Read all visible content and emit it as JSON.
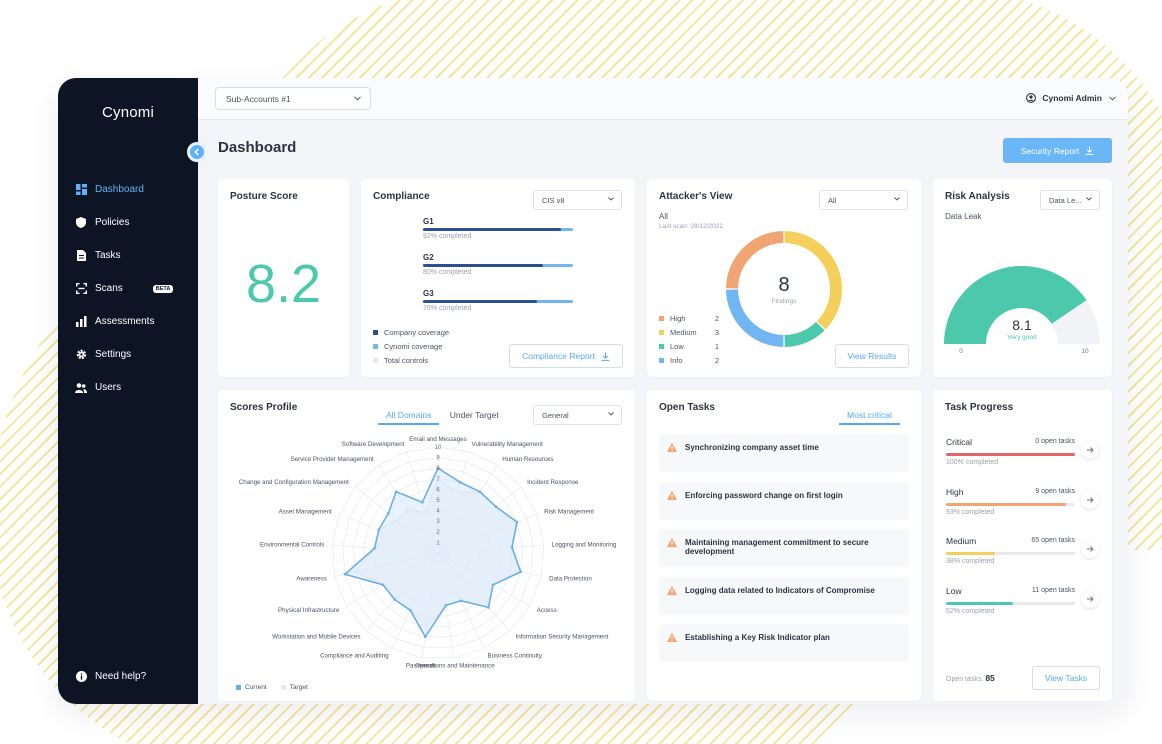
{
  "colors": {
    "sidebar_bg": "#0d1424",
    "accent": "#5fb2f7",
    "teal": "#4cc8ac",
    "orange": "#f0a572",
    "yellow": "#f5cf5c",
    "blue": "#71b6f0",
    "navy": "#2c4f8f",
    "red": "#e0666c"
  },
  "sidebar": {
    "logo": "Cynomi",
    "items": [
      {
        "label": "Dashboard",
        "icon": "grid-icon",
        "active": true
      },
      {
        "label": "Policies",
        "icon": "shield-icon"
      },
      {
        "label": "Tasks",
        "icon": "document-icon"
      },
      {
        "label": "Scans",
        "icon": "scan-icon",
        "badge": "BETA"
      },
      {
        "label": "Assessments",
        "icon": "bar-chart-icon"
      },
      {
        "label": "Settings",
        "icon": "gear-icon"
      },
      {
        "label": "Users",
        "icon": "users-icon"
      }
    ],
    "help": "Need help?"
  },
  "topbar": {
    "subaccount": "Sub-Accounts #1",
    "user": "Cynomi Admin"
  },
  "page": {
    "title": "Dashboard",
    "security_report": "Security Report"
  },
  "posture": {
    "title": "Posture Score",
    "score": "8.2"
  },
  "compliance": {
    "title": "Compliance",
    "select": "CIS v8",
    "groups": [
      {
        "label": "G1",
        "company": 0.92,
        "sub": "92% completed"
      },
      {
        "label": "G2",
        "company": 0.8,
        "sub": "80% completed"
      },
      {
        "label": "G3",
        "company": 0.76,
        "sub": "76% completed"
      }
    ],
    "legend": [
      "Company coverage",
      "Cynomi coverage",
      "Total controls"
    ],
    "button": "Compliance Report"
  },
  "attacker": {
    "title": "Attacker's View",
    "select": "All",
    "scope": "All",
    "last_scan": "Last scan: 28/12/2022",
    "total": "8",
    "total_label": "Findings",
    "severities": [
      {
        "label": "High",
        "value": 2,
        "color": "#f0a572"
      },
      {
        "label": "Medium",
        "value": 3,
        "color": "#f5cf5c"
      },
      {
        "label": "Low",
        "value": 1,
        "color": "#4cc8ac"
      },
      {
        "label": "Info",
        "value": 2,
        "color": "#71b6f0"
      }
    ],
    "button": "View Results"
  },
  "risk": {
    "title": "Risk Analysis",
    "select": "Data Le...",
    "subtitle": "Data Leak",
    "value": 8.1,
    "value_text": "8.1",
    "rating": "Very good",
    "min": "0",
    "max": "10"
  },
  "scores": {
    "title": "Scores Profile",
    "tabs": [
      "All Domains",
      "Under Target"
    ],
    "select": "General",
    "legend_current": "Current",
    "legend_target": "Target",
    "ticks": [
      "1",
      "2",
      "3",
      "4",
      "5",
      "6",
      "7",
      "8",
      "9",
      "10"
    ]
  },
  "chart_data": {
    "type": "radar",
    "rmax": 10,
    "categories": [
      "Email and Messages",
      "Vulnerability Management",
      "Human Resources",
      "Incident Response",
      "Risk Management",
      "Logging and Monitoring",
      "Data Protection",
      "Access",
      "Information Security Management",
      "Business Continuity",
      "Operations and Maintenance",
      "Passwords",
      "Compliance and Auditing",
      "Workstation and Mobile Devices",
      "Physical Infrastructure",
      "Awareness",
      "Environmental Controls",
      "Asset Management",
      "Change and Configuration Management",
      "Service Provider Management",
      "Software Development"
    ],
    "series": [
      {
        "name": "Current",
        "values": [
          8,
          7,
          7,
          7,
          8,
          7,
          8,
          6,
          7,
          5,
          5,
          8,
          6,
          6,
          6,
          9,
          6,
          6,
          6,
          7,
          5
        ]
      },
      {
        "name": "Target",
        "values": [
          7,
          6,
          7,
          7,
          8,
          7,
          8,
          6,
          7,
          5,
          5,
          7,
          6,
          6,
          6,
          8,
          6,
          6,
          5,
          5,
          4
        ]
      }
    ]
  },
  "open_tasks": {
    "title": "Open Tasks",
    "tab": "Most critical",
    "items": [
      "Synchronizing company asset time",
      "Enforcing password change on first login",
      "Maintaining management commitment to secure development",
      "Logging data related to Indicators of Compromise",
      "Establishing a Key Risk Indicator plan"
    ]
  },
  "task_progress": {
    "title": "Task Progress",
    "rows": [
      {
        "label": "Critical",
        "count": "0 open tasks",
        "pct": 1.0,
        "sub": "100% completed",
        "color": "#e0666c"
      },
      {
        "label": "High",
        "count": "9 open tasks",
        "pct": 0.93,
        "sub": "93% completed",
        "color": "#f0a572"
      },
      {
        "label": "Medium",
        "count": "65 open tasks",
        "pct": 0.38,
        "sub": "38% completed",
        "color": "#f5cf5c"
      },
      {
        "label": "Low",
        "count": "11 open tasks",
        "pct": 0.52,
        "sub": "52% completed",
        "color": "#4cc8ac"
      }
    ],
    "open_label": "Open tasks:",
    "open_count": "85",
    "button": "View Tasks"
  }
}
